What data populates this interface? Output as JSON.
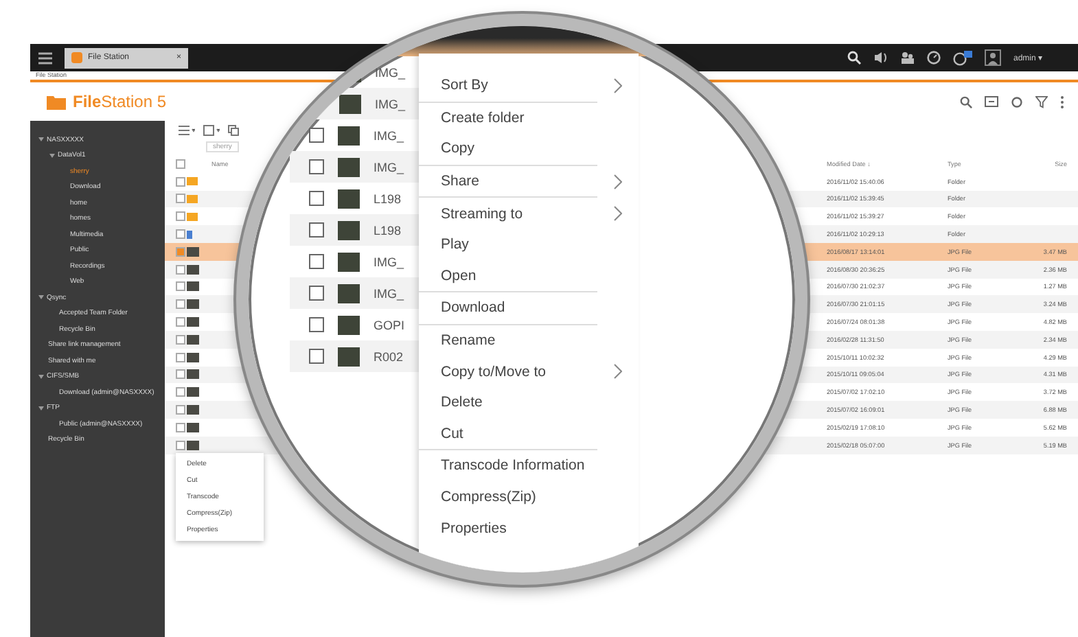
{
  "topbar": {
    "tab": {
      "label": "File Station",
      "close": "×",
      "selected": true
    },
    "user": "admin ▾"
  },
  "window_title": "File Station",
  "header": {
    "logo_bold": "File",
    "logo_rest": "Station 5"
  },
  "path": "sherry",
  "sidebar": [
    {
      "label": "NASXXXXX",
      "selected": false,
      "children": [
        {
          "label": "DataVol1",
          "selected": false,
          "children": [
            {
              "label": "sherry",
              "selected": true
            },
            {
              "label": "Download",
              "selected": false
            },
            {
              "label": "home",
              "selected": false
            },
            {
              "label": "homes",
              "selected": false
            },
            {
              "label": "Multimedia",
              "selected": false
            },
            {
              "label": "Public",
              "selected": false
            },
            {
              "label": "Recordings",
              "selected": false
            },
            {
              "label": "Web",
              "selected": false
            }
          ]
        }
      ]
    },
    {
      "label": "Qsync",
      "selected": false,
      "children": [
        {
          "label": "Accepted Team Folder",
          "selected": false
        },
        {
          "label": "Recycle Bin",
          "selected": false
        }
      ]
    },
    {
      "label": "Share link management",
      "selected": false
    },
    {
      "label": "Shared with me",
      "selected": false
    },
    {
      "label": "CIFS/SMB",
      "selected": false,
      "children": [
        {
          "label": "Download (admin@NASXXXX)",
          "selected": false
        }
      ]
    },
    {
      "label": "FTP",
      "selected": false,
      "children": [
        {
          "label": "Public (admin@NASXXXX)",
          "selected": false
        }
      ]
    },
    {
      "label": "Recycle Bin",
      "selected": false
    }
  ],
  "table": {
    "select_all_checked": false,
    "columns": [
      "Name",
      "Modified Date ↓",
      "Type",
      "Size"
    ],
    "rows": [
      {
        "kind": "folder",
        "modified": "2016/11/02 15:40:06",
        "type": "Folder",
        "size": "",
        "selected": false
      },
      {
        "kind": "folder",
        "modified": "2016/11/02 15:39:45",
        "type": "Folder",
        "size": "",
        "selected": false
      },
      {
        "kind": "folder",
        "modified": "2016/11/02 15:39:27",
        "type": "Folder",
        "size": "",
        "selected": false
      },
      {
        "kind": "link",
        "modified": "2016/11/02 10:29:13",
        "type": "Folder",
        "size": "",
        "selected": false
      },
      {
        "kind": "image",
        "modified": "2016/08/17 13:14:01",
        "type": "JPG File",
        "size": "3.47 MB",
        "selected": true
      },
      {
        "kind": "image",
        "modified": "2016/08/30 20:36:25",
        "type": "JPG File",
        "size": "2.36 MB",
        "selected": false
      },
      {
        "kind": "image",
        "modified": "2016/07/30 21:02:37",
        "type": "JPG File",
        "size": "1.27 MB",
        "selected": false
      },
      {
        "kind": "image",
        "modified": "2016/07/30 21:01:15",
        "type": "JPG File",
        "size": "3.24 MB",
        "selected": false
      },
      {
        "kind": "image",
        "modified": "2016/07/24 08:01:38",
        "type": "JPG File",
        "size": "4.82 MB",
        "selected": false
      },
      {
        "kind": "image",
        "modified": "2016/02/28 11:31:50",
        "type": "JPG File",
        "size": "2.34 MB",
        "selected": false
      },
      {
        "kind": "image",
        "modified": "2015/10/11 10:02:32",
        "type": "JPG File",
        "size": "4.29 MB",
        "selected": false
      },
      {
        "kind": "image",
        "modified": "2015/10/11 09:05:04",
        "type": "JPG File",
        "size": "4.31 MB",
        "selected": false
      },
      {
        "kind": "image",
        "modified": "2015/07/02 17:02:10",
        "type": "JPG File",
        "size": "3.72 MB",
        "selected": false
      },
      {
        "kind": "image",
        "modified": "2015/07/02 16:09:01",
        "type": "JPG File",
        "size": "6.88 MB",
        "selected": false
      },
      {
        "kind": "image",
        "modified": "2015/02/19 17:08:10",
        "type": "JPG File",
        "size": "5.62 MB",
        "selected": false
      },
      {
        "kind": "image",
        "modified": "2015/02/18 05:07:00",
        "type": "JPG File",
        "size": "5.19 MB",
        "selected": false
      }
    ]
  },
  "small_menu": [
    "Delete",
    "Cut",
    "Transcode",
    "Compress(Zip)",
    "Properties"
  ],
  "magnifier": {
    "rows": [
      {
        "name": "IMG_"
      },
      {
        "name": "IMG_"
      },
      {
        "name": "IMG_",
        "checked": false
      },
      {
        "name": "IMG_",
        "checked": false
      },
      {
        "name": "L198",
        "checked": false
      },
      {
        "name": "L198",
        "checked": false
      },
      {
        "name": "IMG_",
        "checked": false
      },
      {
        "name": "IMG_",
        "checked": false
      },
      {
        "name": "GOPI",
        "checked": false
      },
      {
        "name": "R002",
        "checked": false
      }
    ],
    "menu": [
      [
        {
          "label": "Sort By",
          "submenu": true
        }
      ],
      [
        {
          "label": "Create folder",
          "submenu": false
        },
        {
          "label": "Copy",
          "submenu": false
        }
      ],
      [
        {
          "label": "Share",
          "submenu": true
        }
      ],
      [
        {
          "label": "Streaming to",
          "submenu": true
        },
        {
          "label": "Play",
          "submenu": false
        },
        {
          "label": "Open",
          "submenu": false
        }
      ],
      [
        {
          "label": "Download",
          "submenu": false
        }
      ],
      [
        {
          "label": "Rename",
          "submenu": false
        },
        {
          "label": "Copy to/Move to",
          "submenu": true
        },
        {
          "label": "Delete",
          "submenu": false
        },
        {
          "label": "Cut",
          "submenu": false
        }
      ],
      [
        {
          "label": "Transcode Information",
          "submenu": false
        },
        {
          "label": "Compress(Zip)",
          "submenu": false
        },
        {
          "label": "Properties",
          "submenu": false
        }
      ]
    ]
  }
}
